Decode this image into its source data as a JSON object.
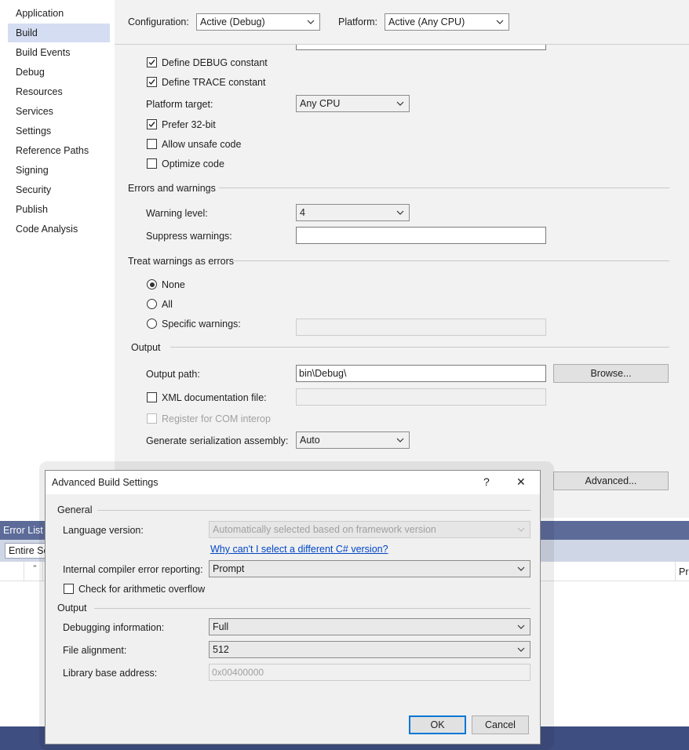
{
  "nav": {
    "items": [
      {
        "label": "Application"
      },
      {
        "label": "Build",
        "selected": true
      },
      {
        "label": "Build Events"
      },
      {
        "label": "Debug"
      },
      {
        "label": "Resources"
      },
      {
        "label": "Services"
      },
      {
        "label": "Settings"
      },
      {
        "label": "Reference Paths"
      },
      {
        "label": "Signing"
      },
      {
        "label": "Security"
      },
      {
        "label": "Publish"
      },
      {
        "label": "Code Analysis"
      }
    ]
  },
  "top": {
    "configuration_label": "Configuration:",
    "configuration_value": "Active (Debug)",
    "platform_label": "Platform:",
    "platform_value": "Active (Any CPU)"
  },
  "general": {
    "define_debug": "Define DEBUG constant",
    "define_debug_checked": true,
    "define_trace": "Define TRACE constant",
    "define_trace_checked": true,
    "platform_target_label": "Platform target:",
    "platform_target_value": "Any CPU",
    "prefer32": "Prefer 32-bit",
    "prefer32_checked": true,
    "unsafe": "Allow unsafe code",
    "unsafe_checked": false,
    "optimize": "Optimize code",
    "optimize_checked": false
  },
  "errors": {
    "section": "Errors and warnings",
    "warning_level_label": "Warning level:",
    "warning_level_value": "4",
    "suppress_label": "Suppress warnings:",
    "suppress_value": ""
  },
  "treat": {
    "section": "Treat warnings as errors",
    "none": "None",
    "all": "All",
    "specific": "Specific warnings:",
    "selected": "none"
  },
  "output": {
    "section": "Output",
    "path_label": "Output path:",
    "path_value": "bin\\Debug\\",
    "browse": "Browse...",
    "xml_doc": "XML documentation file:",
    "xml_doc_checked": false,
    "com_interop": "Register for COM interop",
    "serialization_label": "Generate serialization assembly:",
    "serialization_value": "Auto",
    "advanced": "Advanced..."
  },
  "errorlist": {
    "title": "Error List",
    "scope": "Entire So",
    "col_right": "Pr"
  },
  "dialog": {
    "title": "Advanced Build Settings",
    "help": "?",
    "close": "✕",
    "general_section": "General",
    "language_label": "Language version:",
    "language_value": "Automatically selected based on framework version",
    "why_link": "Why can't I select a different C# version?",
    "ice_label": "Internal compiler error reporting:",
    "ice_value": "Prompt",
    "overflow": "Check for arithmetic overflow",
    "overflow_checked": false,
    "output_section": "Output",
    "debug_info_label": "Debugging information:",
    "debug_info_value": "Full",
    "file_align_label": "File alignment:",
    "file_align_value": "512",
    "base_addr_label": "Library base address:",
    "base_addr_value": "0x00400000",
    "ok": "OK",
    "cancel": "Cancel"
  },
  "colors": {
    "nav_selected": "#d4ddf2",
    "panel_bg": "#f2f2f2",
    "errorlist_title": "#5d6b99",
    "accent": "#0078d7",
    "link": "#0046c8"
  }
}
